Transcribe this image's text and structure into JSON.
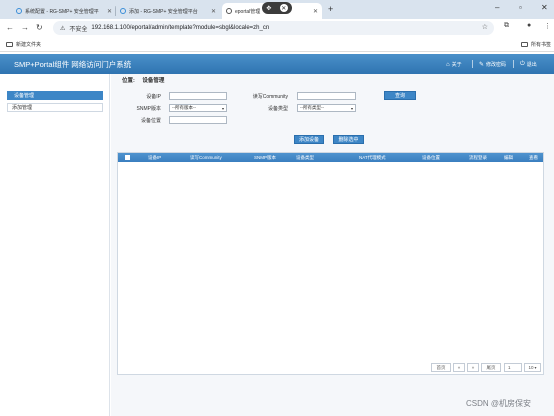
{
  "browser": {
    "tabs": [
      {
        "title": "系统配置 - RG-SMP+ 安全管理平",
        "active": false
      },
      {
        "title": "添加 - RG-SMP+ 安全管理平台",
        "active": false
      },
      {
        "title": "eportal管理",
        "active": true
      }
    ],
    "url": "192.168.1.100/eportal/admin/template?module=sbgl&locale=zh_cn",
    "security_label": "不安全",
    "bookmarks": [
      "新建文件夹"
    ],
    "all_bookmarks_label": "所有书签"
  },
  "app": {
    "title": "SMP+Portal组件 网络访问门户系统",
    "nav": [
      {
        "label": "关于",
        "icon": "home-icon"
      },
      {
        "label": "修改密码",
        "icon": "wrench-icon"
      },
      {
        "label": "退出",
        "icon": "power-icon"
      }
    ],
    "sidebar": [
      {
        "label": "设备管理",
        "active": true
      },
      {
        "label": "添加管理",
        "active": false
      }
    ],
    "breadcrumb": {
      "prefix": "位置:",
      "current": "设备管理"
    },
    "form": {
      "device_ip_label": "设备IP",
      "read_community_label": "读写Community",
      "snmp_version_label": "SNMP版本",
      "snmp_version_value": "--所有版本--",
      "device_type_label": "设备类型",
      "device_type_value": "--所有类型--",
      "device_location_label": "设备位置",
      "query_button": "查询",
      "add_button": "添加设备",
      "delete_button": "删除选中"
    },
    "table": {
      "columns": [
        "设备IP",
        "读写Community",
        "SNMP版本",
        "设备类型",
        "NAT代理模式",
        "设备位置",
        "流程登录",
        "编辑",
        "查看"
      ],
      "rows": []
    },
    "pager": {
      "first": "首页",
      "prev": "«",
      "next": "»",
      "last": "尾页",
      "page": "1",
      "per_page": "10"
    }
  },
  "watermark": "CSDN @机房保安"
}
